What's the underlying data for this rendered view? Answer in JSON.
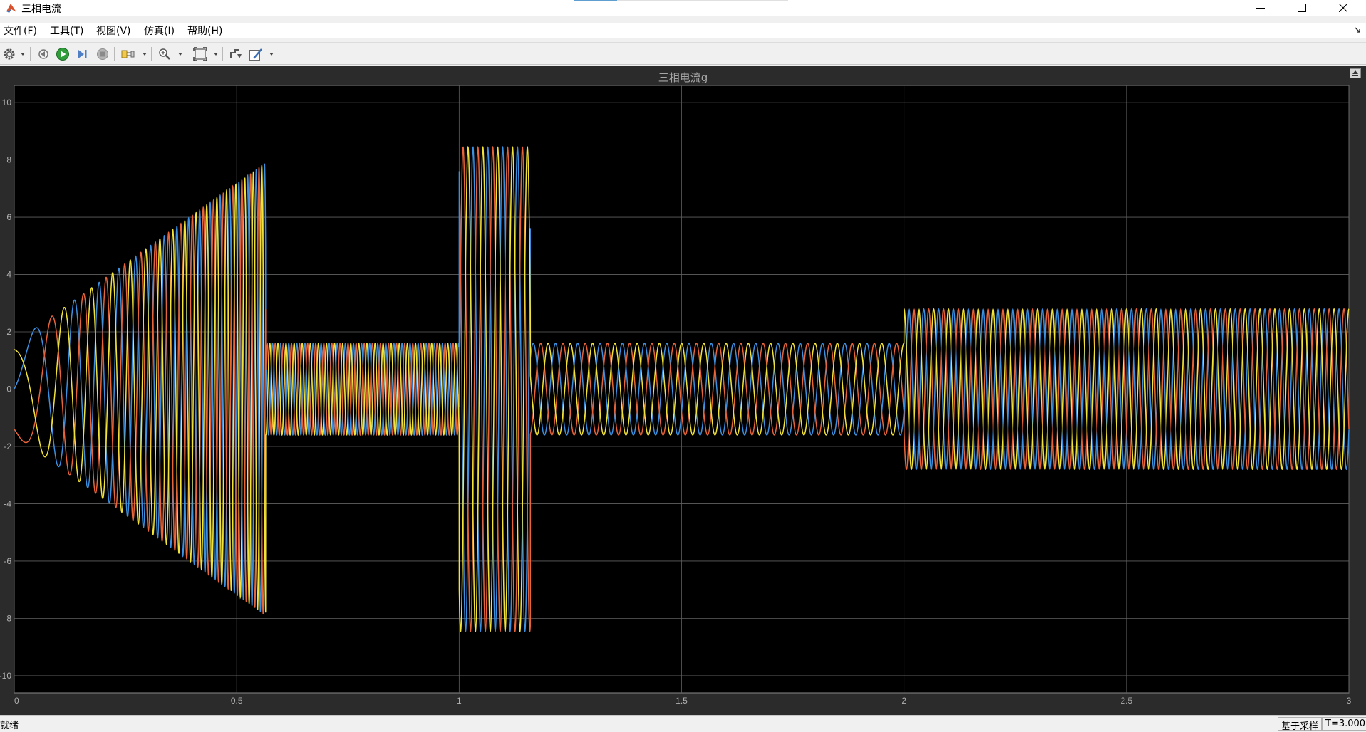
{
  "window": {
    "title": "三相电流"
  },
  "menu": [
    {
      "label": "文件(F)"
    },
    {
      "label": "工具(T)"
    },
    {
      "label": "视图(V)"
    },
    {
      "label": "仿真(I)"
    },
    {
      "label": "帮助(H)"
    }
  ],
  "toolbar": {
    "buttons": [
      {
        "icon": "settings-icon"
      },
      {
        "icon": "step-back-icon"
      },
      {
        "icon": "run-icon"
      },
      {
        "icon": "step-forward-icon"
      },
      {
        "icon": "stop-icon"
      },
      {
        "icon": "highlight-block-icon"
      },
      {
        "icon": "zoom-in-icon"
      },
      {
        "icon": "autoscale-icon"
      },
      {
        "icon": "trigger-icon"
      },
      {
        "icon": "style-icon"
      }
    ]
  },
  "plot": {
    "title": "三相电流g"
  },
  "status": {
    "text": "就绪",
    "mode": "基于采样",
    "time": "T=3.000"
  },
  "colors": {
    "phase_a": "#3d8fe0",
    "phase_b": "#e8643a",
    "phase_c": "#f2e33b",
    "background": "#000000",
    "grid": "#606060"
  },
  "chart_data": {
    "type": "line",
    "title": "三相电流g",
    "xlim": [
      0,
      3
    ],
    "ylim": [
      -10.6,
      10.6
    ],
    "x_ticks": [
      0,
      0.5,
      1,
      1.5,
      2,
      2.5,
      3
    ],
    "x_tick_labels": [
      "0",
      "0.5",
      "1",
      "1.5",
      "2",
      "2.5",
      "3"
    ],
    "y_ticks": [
      10,
      8,
      6,
      4,
      2,
      0,
      -2,
      -4,
      -6,
      -8,
      -10
    ],
    "y_tick_labels": [
      "10",
      "8",
      "6",
      "4",
      "2",
      "0",
      "-2",
      "-4",
      "-6",
      "-8",
      "-10"
    ],
    "grid": true,
    "waveform": "three-phase sinusoid, phases 120° apart",
    "segments": [
      {
        "t_start": 0,
        "t_end": 0.565,
        "amplitude_start": 1.6,
        "amplitude_end": 7.9,
        "freq_start_hz": 3,
        "freq_end_hz": 55
      },
      {
        "t_start": 0.565,
        "t_end": 1.0,
        "amplitude": 1.6,
        "freq_hz": 55
      },
      {
        "t_start": 1.0,
        "t_end": 1.16,
        "amplitude": 8.45,
        "freq_hz": 30
      },
      {
        "t_start": 1.16,
        "t_end": 2.0,
        "amplitude": 1.6,
        "freq_hz": 20
      },
      {
        "t_start": 2.0,
        "t_end": 3.0,
        "amplitude": 2.8,
        "freq_hz": 30
      }
    ],
    "series": [
      {
        "color": "#3d8fe0",
        "phase_offset_deg": 0
      },
      {
        "color": "#e8643a",
        "phase_offset_deg": -120
      },
      {
        "color": "#f2e33b",
        "phase_offset_deg": 120
      }
    ]
  }
}
